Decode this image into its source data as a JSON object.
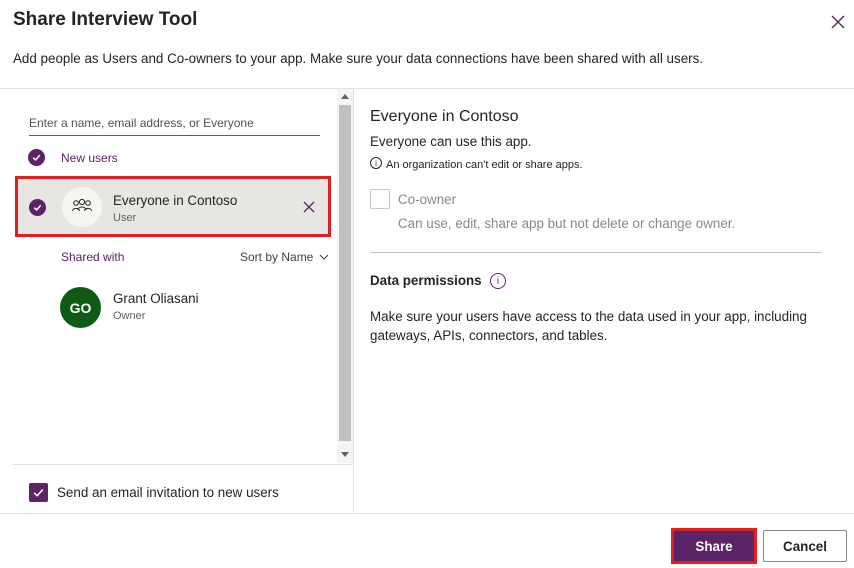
{
  "dialog": {
    "title": "Share Interview Tool",
    "subtitle": "Add people as Users and Co-owners to your app. Make sure your data connections have been shared with all users."
  },
  "search": {
    "placeholder": "Enter a name, email address, or Everyone"
  },
  "new_users": {
    "label": "New users",
    "items": [
      {
        "name": "Everyone in Contoso",
        "role": "User"
      }
    ]
  },
  "shared_with": {
    "label": "Shared with",
    "sort_label": "Sort by Name",
    "items": [
      {
        "initials": "GO",
        "name": "Grant Oliasani",
        "role": "Owner"
      }
    ]
  },
  "email_invitation": {
    "label": "Send an email invitation to new users",
    "checked": true
  },
  "details": {
    "title": "Everyone in Contoso",
    "description": "Everyone can use this app.",
    "info_text": "An organization can't edit or share apps.",
    "coowner_label": "Co-owner",
    "coowner_description": "Can use, edit, share app but not delete or change owner.",
    "data_permissions_title": "Data permissions",
    "data_permissions_text": "Make sure your users have access to the data used in your app, including gateways, APIs, connectors, and tables."
  },
  "footer": {
    "share_label": "Share",
    "cancel_label": "Cancel"
  },
  "colors": {
    "accent": "#5c2366",
    "highlight": "#e0201f",
    "avatar_green": "#0e5c14"
  },
  "icons": {
    "close": "close-icon",
    "check": "check-icon",
    "group": "people-group-icon",
    "remove": "remove-icon",
    "chevron": "chevron-down-icon",
    "info": "info-icon"
  }
}
